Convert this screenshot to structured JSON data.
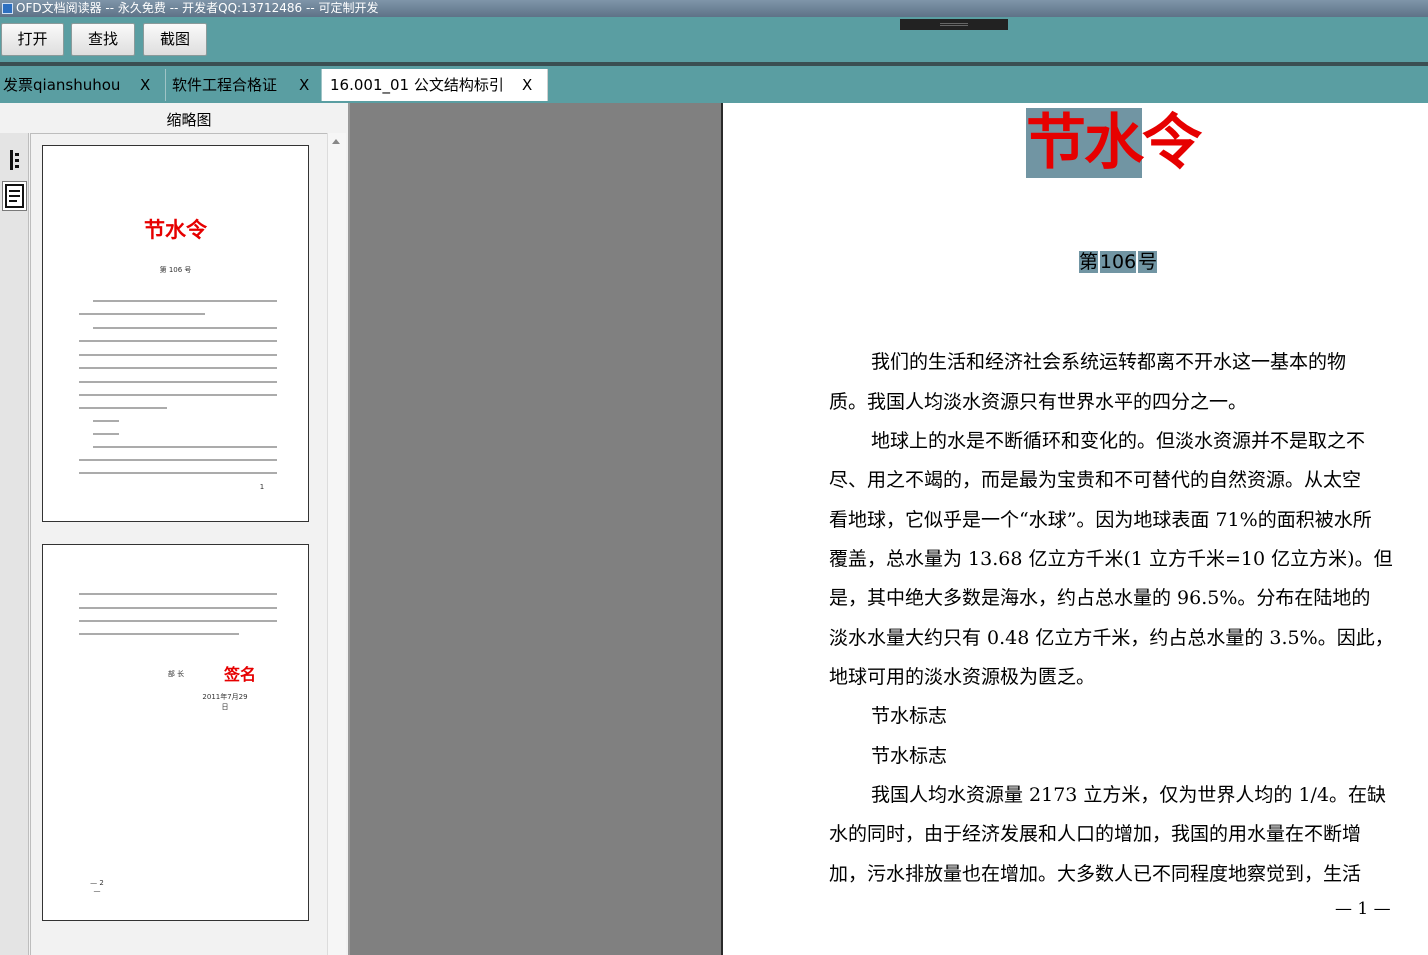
{
  "window": {
    "title": "OFD文档阅读器 -- 永久免费 -- 开发者QQ:13712486 -- 可定制开发"
  },
  "toolbar": {
    "open_label": "打开",
    "find_label": "查找",
    "screenshot_label": "截图"
  },
  "tabs": [
    {
      "label": "发票qianshuhou",
      "close": "X",
      "active": false
    },
    {
      "label": "软件工程合格证",
      "close": "X",
      "active": false
    },
    {
      "label": "16.001_01 公文结构标引",
      "close": "X",
      "active": true
    }
  ],
  "sidebar": {
    "title": "缩略图",
    "icons": [
      "outline-icon",
      "thumbnail-view-icon"
    ],
    "thumbnails": [
      {
        "title": "节水令",
        "subtitle": "第 106 号",
        "page": "1"
      },
      {
        "signer_label": "部 长",
        "signature": "签名",
        "date": "2011年7月29日",
        "page": "— 2 —"
      }
    ]
  },
  "document": {
    "title_part1": "节水",
    "title_part2": "令",
    "number_prefix": "第",
    "number_value": "106",
    "number_suffix": "号",
    "lines": [
      "我们的生活和经济社会系统运转都离不开水这一基本的物",
      "质。我国人均淡水资源只有世界水平的四分之一。",
      "地球上的水是不断循环和变化的。但淡水资源并不是取之不",
      "尽、用之不竭的，而是最为宝贵和不可替代的自然资源。从太空",
      "看地球，它似乎是一个“水球”。因为地球表面 71%的面积被水所",
      "覆盖，总水量为 13.68 亿立方千米(1 立方千米=10 亿立方米)。但",
      "是，其中绝大多数是海水，约占总水量的 96.5%。分布在陆地的",
      "淡水水量大约只有 0.48 亿立方千米，约占总水量的 3.5%。因此，",
      "地球可用的淡水资源极为匮乏。",
      "节水标志",
      "节水标志",
      "我国人均水资源量 2173 立方米，仅为世界人均的 1/4。在缺",
      "水的同时，由于经济发展和人口的增加，我国的用水量在不断增",
      "加，污水排放量也在增加。大多数人已不同程度地察觉到，生活"
    ],
    "page_number": "— 1 —"
  }
}
